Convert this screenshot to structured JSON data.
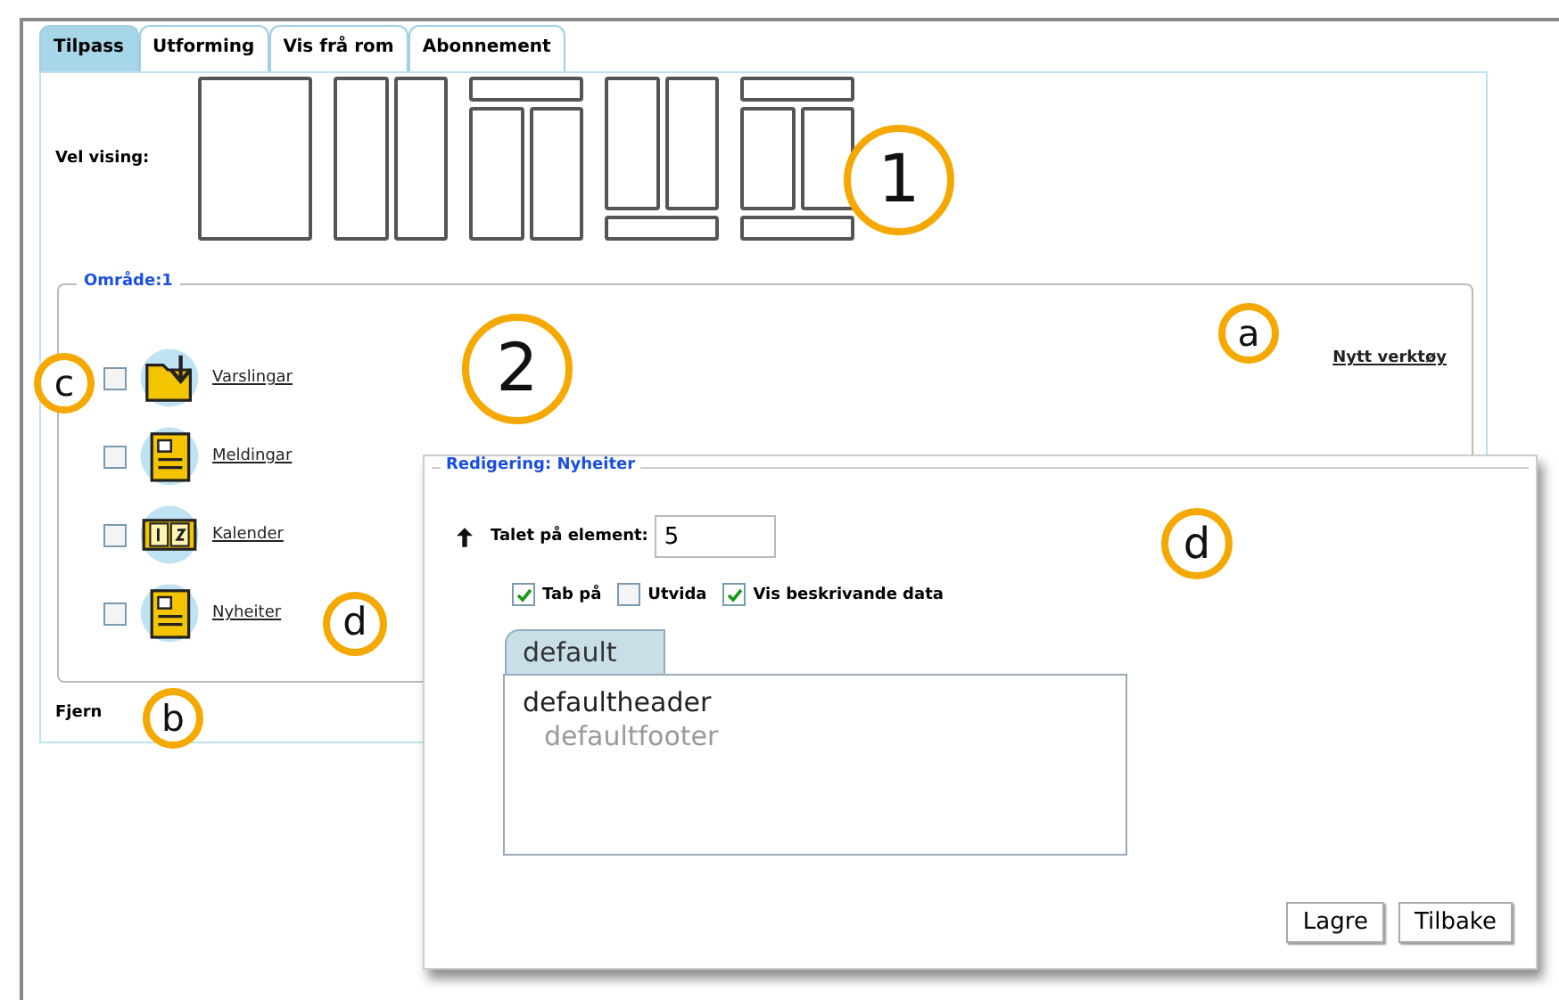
{
  "tabs": [
    {
      "label": "Tilpass",
      "selected": true
    },
    {
      "label": "Utforming",
      "selected": false
    },
    {
      "label": "Vis frå rom",
      "selected": false
    },
    {
      "label": "Abonnement",
      "selected": false
    }
  ],
  "layout_picker": {
    "label": "Vel vising:",
    "options": [
      {
        "kind": "single"
      },
      {
        "kind": "two-col"
      },
      {
        "kind": "top-two-col"
      },
      {
        "kind": "two-col-bottom"
      },
      {
        "kind": "top-two-col-bottom"
      }
    ]
  },
  "area": {
    "title": "Område:1",
    "new_tool_link": "Nytt verktøy",
    "tools": [
      {
        "label": "Varslingar",
        "kind": "folder",
        "checked": false
      },
      {
        "label": "Meldingar",
        "kind": "note",
        "checked": false
      },
      {
        "label": "Kalender",
        "kind": "calendar",
        "checked": false
      },
      {
        "label": "Nyheiter",
        "kind": "note",
        "checked": false
      }
    ]
  },
  "remove_label": "Fjern",
  "dialog": {
    "title": "Redigering: Nyheiter",
    "count_label": "Talet på element:",
    "count_value": "5",
    "options": [
      {
        "label": "Tab på",
        "checked": true
      },
      {
        "label": "Utvida",
        "checked": false
      },
      {
        "label": "Vis beskrivande data",
        "checked": true
      }
    ],
    "tab": "default",
    "items": [
      {
        "label": "defaultheader",
        "disabled": false,
        "children": [
          {
            "label": "defaultfooter",
            "disabled": true
          }
        ]
      }
    ],
    "buttons": [
      "Lagre",
      "Tilbake"
    ]
  },
  "callouts": [
    {
      "label": "1"
    },
    {
      "label": "2"
    },
    {
      "label": "a"
    },
    {
      "label": "b"
    },
    {
      "label": "c"
    },
    {
      "label": "d"
    },
    {
      "label": "d"
    }
  ]
}
